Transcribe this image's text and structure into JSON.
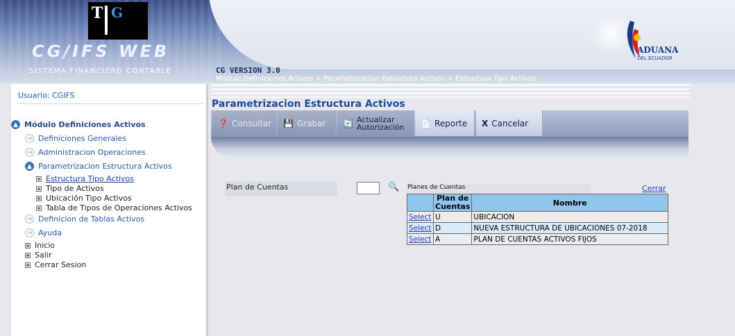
{
  "header": {
    "logo_letters": "T",
    "logo_g": "G",
    "app_title": "CG/IFS WEB",
    "app_subtitle": "SISTEMA FINANCIERO CONTABLE",
    "version": "CG VERSION 3.0",
    "breadcrumb": "Módulo Definiciones Activos > Parametrizacion Estructura Activos > Estructura Tipo Activos",
    "partner_logo": "ADUANA",
    "partner_logo_sub": "DEL ECUADOR"
  },
  "sidebar": {
    "user": "Usuario: CGIFS",
    "module": "Módulo Definiciones Activos",
    "items": [
      {
        "label": "Definiciones Generales"
      },
      {
        "label": "Administracion Operaciones"
      },
      {
        "label": "Parametrizacion Estructura Activos"
      }
    ],
    "sub_items": [
      {
        "label": "Estructura Tipo Activos"
      },
      {
        "label": "Tipo de Activos"
      },
      {
        "label": "Ubicación Tipo Activos"
      },
      {
        "label": "Tabla de Tipos de Operaciones Activos"
      }
    ],
    "more_items": [
      {
        "label": "Definicion de Tablas Activos"
      },
      {
        "label": "Ayuda"
      }
    ],
    "bottom_items": [
      {
        "label": "Inicio"
      },
      {
        "label": "Salir"
      },
      {
        "label": "Cerrar Sesion"
      }
    ]
  },
  "main": {
    "title": "Parametrizacion Estructura Activos",
    "toolbar": {
      "consultar": "Consultar",
      "grabar": "Grabar",
      "actualizar_1": "Actualizar",
      "actualizar_2": "Autorización",
      "reporte": "Reporte",
      "cancelar": "Cancelar"
    },
    "field_label": "Plan de Cuentas",
    "popup_title": "Planes de Cuentas",
    "close_label": "Cerrar",
    "grid": {
      "headers": [
        "",
        "Plan de Cuentas",
        "Nombre"
      ],
      "select_label": "Select",
      "rows": [
        {
          "code": "U",
          "name": "UBICACION"
        },
        {
          "code": "D",
          "name": "NUEVA ESTRUCTURA DE UBICACIONES 07-2018"
        },
        {
          "code": "A",
          "name": "PLAN DE CUENTAS ACTIVOS FIJOS"
        }
      ]
    }
  },
  "colors": {
    "header_blue": "#3b4f86",
    "link_blue": "#1a3ac8",
    "grid_header": "#8fc6ec"
  }
}
